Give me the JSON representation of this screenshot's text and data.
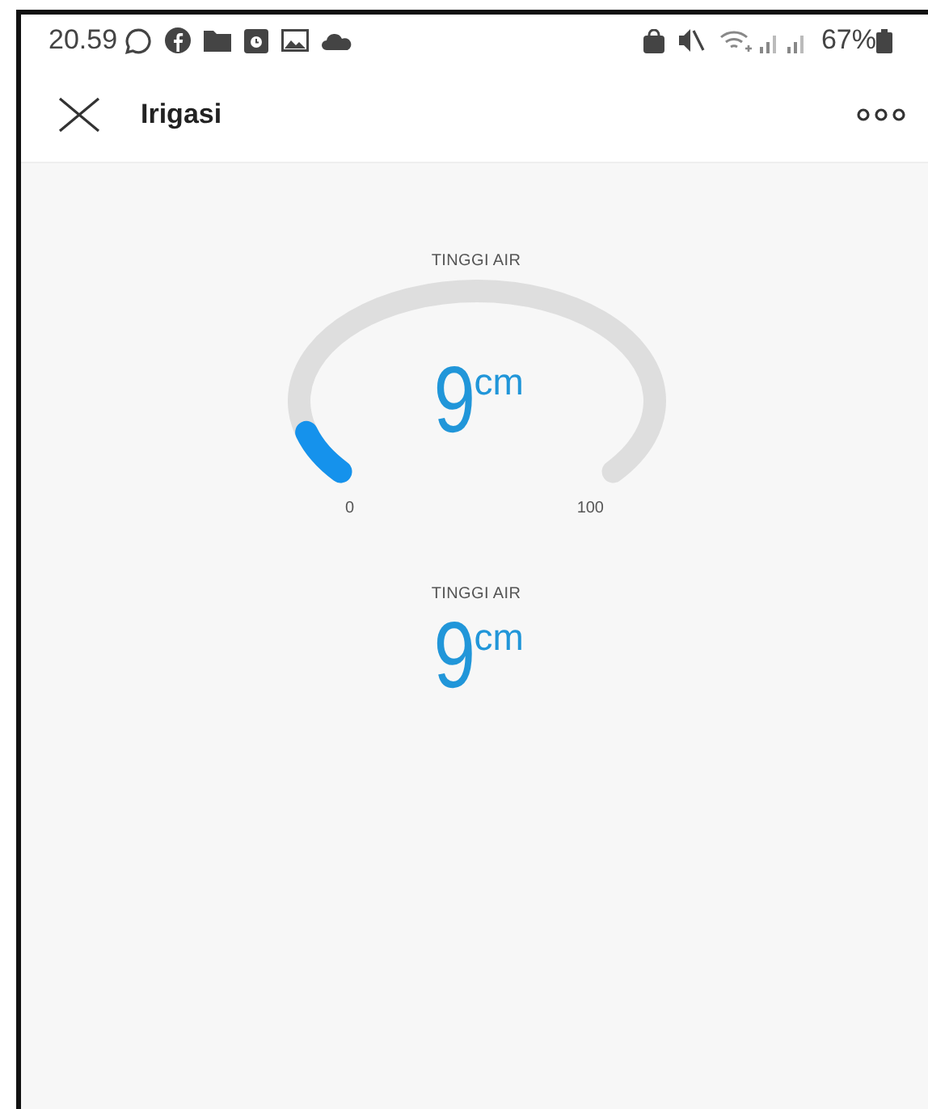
{
  "status_bar": {
    "time": "20.59",
    "battery": "67%"
  },
  "header": {
    "title": "Irigasi"
  },
  "gauge": {
    "label": "TINGGI AIR",
    "value": "9",
    "unit": "cm",
    "min": "0",
    "max": "100",
    "level": 0.09
  },
  "readout": {
    "label": "TINGGI AIR",
    "value": "9",
    "unit": "cm"
  }
}
